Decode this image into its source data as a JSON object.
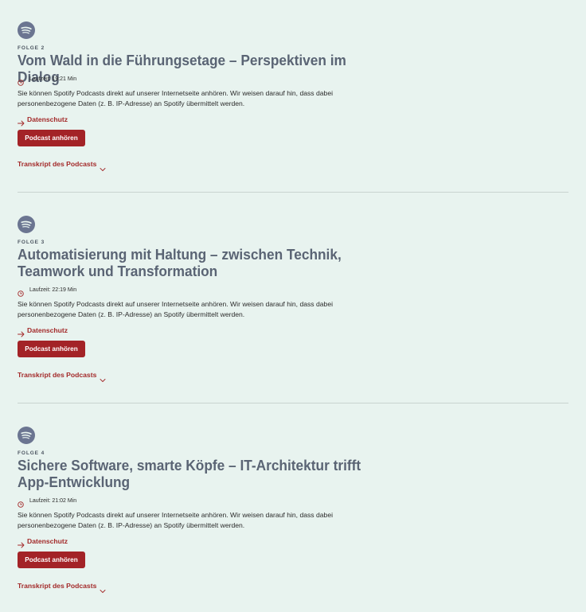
{
  "colors": {
    "background": "#e8f3ef",
    "title": "#5a6474",
    "accent": "#a32327",
    "icon_badge": "#6b7591"
  },
  "icons": {
    "episode_badge": "spotify-icon",
    "runtime": "clock-icon",
    "link": "arrow-right-icon",
    "transcript_toggle": "chevron-down-icon"
  },
  "episodes": [
    {
      "label": "FOLGE 2",
      "title": "Vom Wald in die Führungsetage – Perspektiven im Dialog",
      "runtime": "Laufzeit: 19:21 Min",
      "notice": "Sie können Spotify Podcasts direkt auf unserer Internetseite anhören. Wir weisen darauf hin, dass dabei personenbezogene Daten (z. B. IP-Adresse) an Spotify übermittelt werden.",
      "privacy_link": "Datenschutz",
      "play_button": "Podcast anhören",
      "transcript": "Transkript des Podcasts"
    },
    {
      "label": "FOLGE 3",
      "title": "Automatisierung mit Haltung – zwischen Technik, Teamwork und Transformation",
      "runtime": "Laufzeit: 22:19 Min",
      "notice": "Sie können Spotify Podcasts direkt auf unserer Internetseite anhören. Wir weisen darauf hin, dass dabei personenbezogene Daten (z. B. IP-Adresse) an Spotify übermittelt werden.",
      "privacy_link": "Datenschutz",
      "play_button": "Podcast anhören",
      "transcript": "Transkript des Podcasts"
    },
    {
      "label": "FOLGE 4",
      "title": "Sichere Software, smarte Köpfe – IT-Architektur trifft App-Entwicklung",
      "runtime": "Laufzeit: 21:02 Min",
      "notice": "Sie können Spotify Podcasts direkt auf unserer Internetseite anhören. Wir weisen darauf hin, dass dabei personenbezogene Daten (z. B. IP-Adresse) an Spotify übermittelt werden.",
      "privacy_link": "Datenschutz",
      "play_button": "Podcast anhören",
      "transcript": "Transkript des Podcasts"
    }
  ]
}
